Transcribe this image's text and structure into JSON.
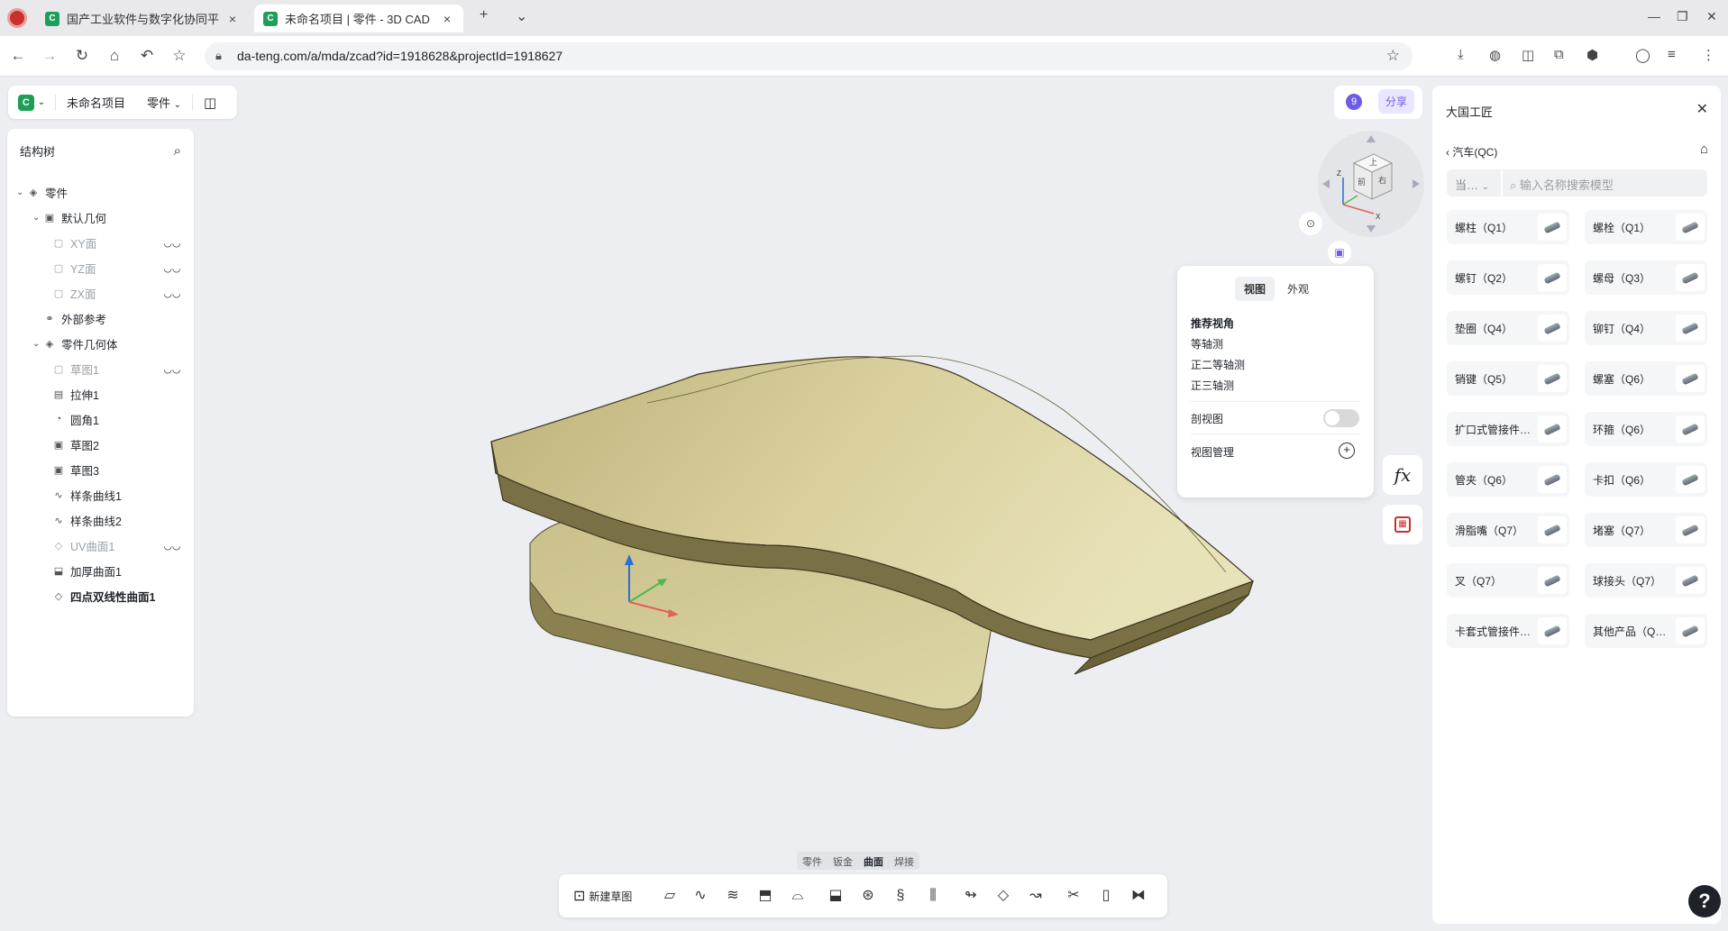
{
  "browser": {
    "tabs": [
      {
        "title": "国产工业软件与数字化协同平",
        "close": "×"
      },
      {
        "title": "未命名项目 | 零件 - 3D CAD",
        "close": "×"
      }
    ],
    "new_tab": "+",
    "tab_list": "⌄",
    "url": "da-teng.com/a/mda/zcad?id=1918628&projectId=1918627"
  },
  "app": {
    "project_name": "未命名项目",
    "doc_type": "零件",
    "badge_count": "9",
    "share_label": "分享"
  },
  "structure_tree": {
    "title": "结构树",
    "items": [
      {
        "label": "零件"
      },
      {
        "label": "默认几何"
      },
      {
        "label": "XY面"
      },
      {
        "label": "YZ面"
      },
      {
        "label": "ZX面"
      },
      {
        "label": "外部参考"
      },
      {
        "label": "零件几何体"
      },
      {
        "label": "草图1"
      },
      {
        "label": "拉伸1"
      },
      {
        "label": "圆角1"
      },
      {
        "label": "草图2"
      },
      {
        "label": "草图3"
      },
      {
        "label": "样条曲线1"
      },
      {
        "label": "样条曲线2"
      },
      {
        "label": "UV曲面1"
      },
      {
        "label": "加厚曲面1"
      },
      {
        "label": "四点双线性曲面1"
      }
    ]
  },
  "view_panel": {
    "tabs": [
      "视图",
      "外观"
    ],
    "section_title": "推荐视角",
    "views": [
      "等轴测",
      "正二等轴测",
      "正三轴测"
    ],
    "section_view_label": "剖视图",
    "view_manage_label": "视图管理"
  },
  "viewcube": {
    "labels": [
      "Z",
      "X",
      "前",
      "右",
      "上"
    ]
  },
  "fx_label": "fx",
  "right_panel": {
    "title": "大国工匠",
    "breadcrumb": "汽车(QC)",
    "filter_value": "当…",
    "search_placeholder": "输入名称搜索模型",
    "items": [
      "螺柱（Q1）",
      "螺栓（Q1）",
      "螺钉（Q2）",
      "螺母（Q3）",
      "垫圈（Q4）",
      "铆钉（Q4）",
      "销键（Q5）",
      "螺塞（Q6）",
      "扩口式管接件…",
      "环箍（Q6）",
      "管夹（Q6）",
      "卡扣（Q6）",
      "滑脂嘴（Q7）",
      "堵塞（Q7）",
      "叉（Q7）",
      "球接头（Q7）",
      "卡套式管接件…",
      "其他产品（Q…"
    ]
  },
  "bottom": {
    "categories": [
      "零件",
      "钣金",
      "曲面",
      "焊接"
    ],
    "new_sketch": "新建草图"
  },
  "help": "?",
  "colors": {
    "accent": "#6c5ce7",
    "brand": "#1f9e5a",
    "model": "#d8d0a0"
  }
}
